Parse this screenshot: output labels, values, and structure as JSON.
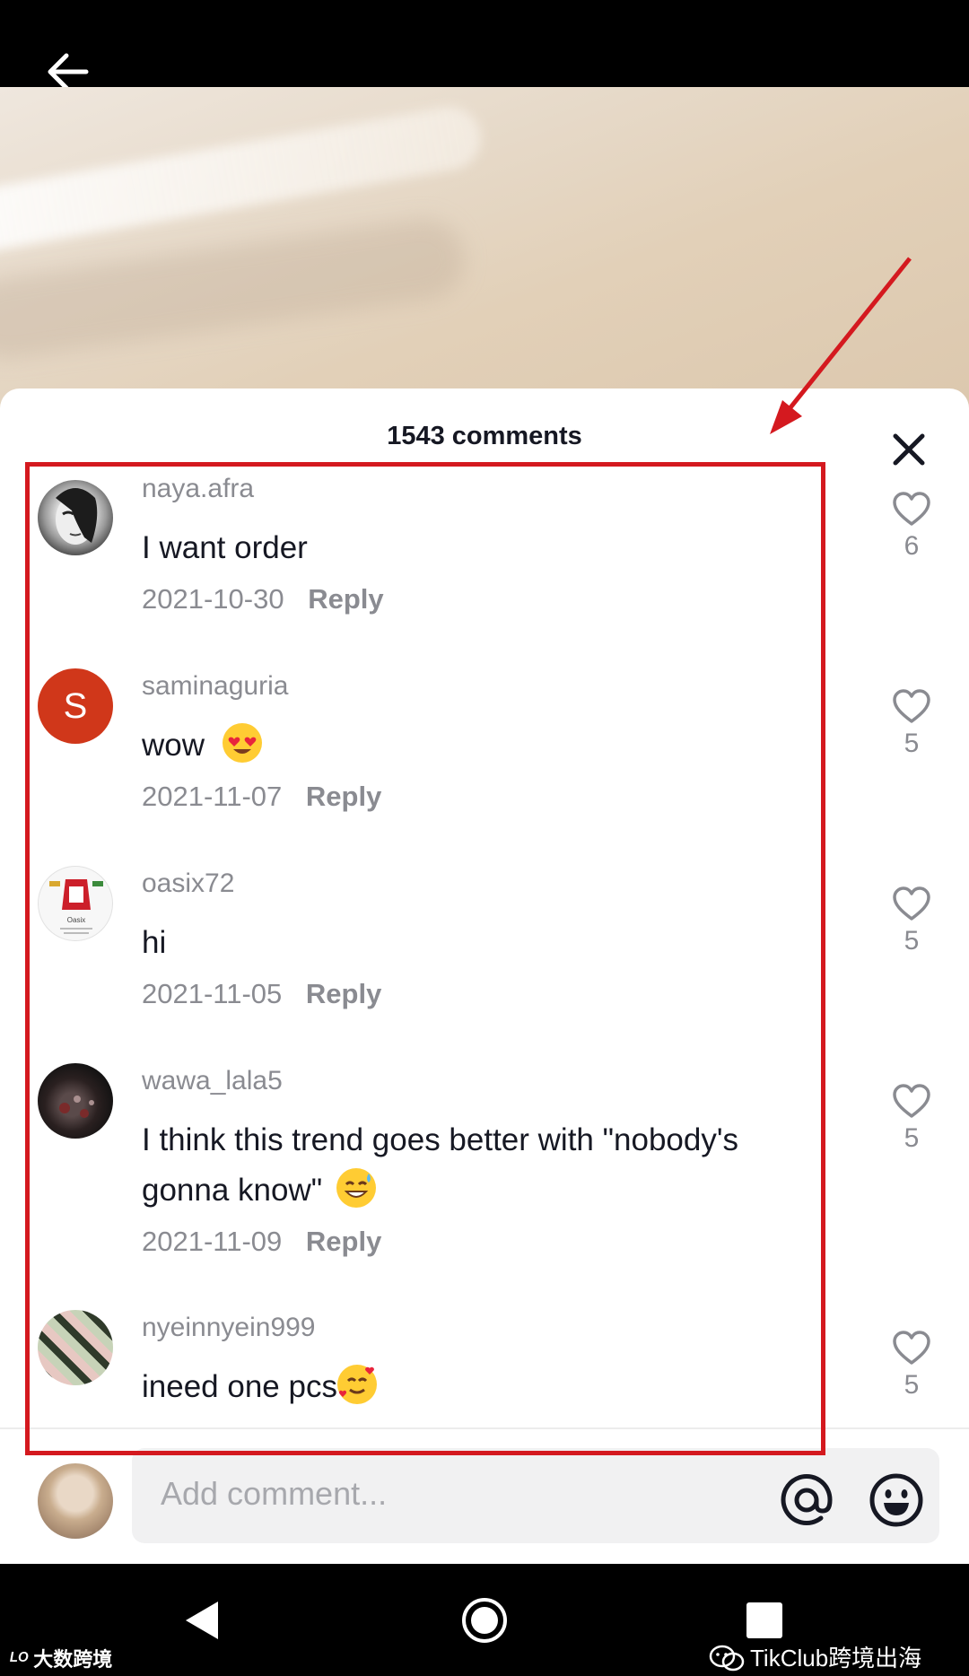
{
  "header": {
    "back_icon": "arrow-left-icon"
  },
  "sheet": {
    "title": "1543 comments",
    "close_icon": "close-icon"
  },
  "comments": [
    {
      "username": "naya.afra",
      "text": "I want order",
      "emoji": "",
      "date": "2021-10-30",
      "reply_label": "Reply",
      "likes": "6"
    },
    {
      "username": "saminaguria",
      "avatar_letter": "S",
      "avatar_color": "#d0371a",
      "text": "wow",
      "emoji": "heart-eyes-emoji",
      "date": "2021-11-07",
      "reply_label": "Reply",
      "likes": "5"
    },
    {
      "username": "oasix72",
      "avatar_logo_text": "Oasix",
      "text": "hi",
      "emoji": "",
      "date": "2021-11-05",
      "reply_label": "Reply",
      "likes": "5"
    },
    {
      "username": "wawa_lala5",
      "text": "I think this trend goes better with \"nobody's gonna know\"",
      "emoji": "sweat-smile-emoji",
      "date": "2021-11-09",
      "reply_label": "Reply",
      "likes": "5"
    },
    {
      "username": "nyeinnyein999",
      "text": "ineed one pcs",
      "emoji": "smiling-hearts-emoji",
      "likes": "5"
    }
  ],
  "input": {
    "placeholder": "Add comment...",
    "at_icon": "at-icon",
    "emoji_icon": "emoji-icon"
  },
  "watermark": {
    "right": "TikClub跨境出海",
    "left": "大数跨境"
  },
  "colors": {
    "annotation": "#d4191f",
    "text_primary": "#161823",
    "text_secondary": "#8a8b91"
  }
}
